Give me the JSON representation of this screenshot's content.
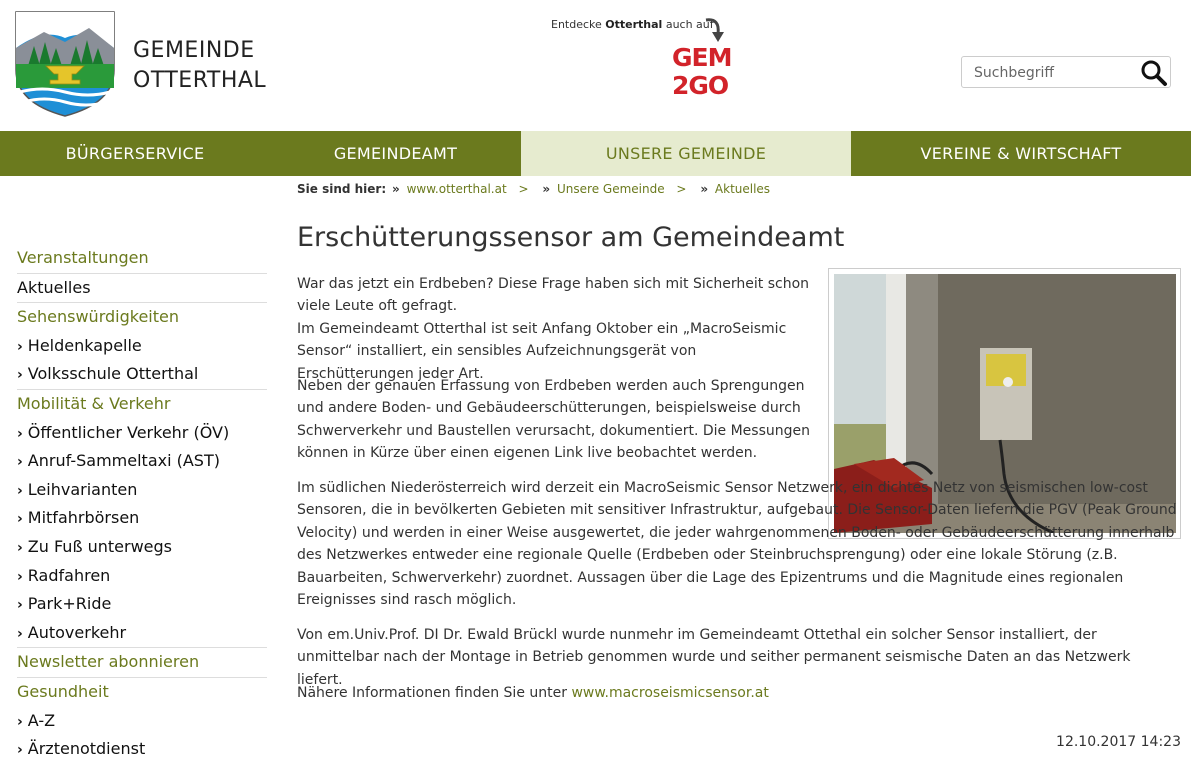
{
  "header": {
    "brand_line1": "GEMEINDE",
    "brand_line2": "OTTERTHAL",
    "g2g_prefix": "Entdecke",
    "g2g_name": "Otterthal",
    "g2g_suffix": "auch auf",
    "g2g_logo_line1": "GEM",
    "g2g_logo_line2": "2GO",
    "search_placeholder": "Suchbegriff"
  },
  "nav": {
    "items": [
      {
        "label": "BÜRGERSERVICE"
      },
      {
        "label": "GEMEINDEAMT"
      },
      {
        "label": "UNSERE GEMEINDE",
        "active": true
      },
      {
        "label": "VEREINE & WIRTSCHAFT"
      }
    ]
  },
  "breadcrumb": {
    "label": "Sie sind hier:",
    "items": [
      "www.otterthal.at",
      "Unsere Gemeinde",
      "Aktuelles"
    ]
  },
  "sidebar": {
    "items": [
      {
        "label": "Veranstaltungen",
        "type": "head"
      },
      {
        "label": "Aktuelles",
        "type": "plain"
      },
      {
        "label": "Sehenswürdigkeiten",
        "type": "head"
      },
      {
        "label": "Heldenkapelle",
        "type": "sub"
      },
      {
        "label": "Volksschule Otterthal",
        "type": "sub"
      },
      {
        "label": "Mobilität & Verkehr",
        "type": "head"
      },
      {
        "label": "Öffentlicher Verkehr (ÖV)",
        "type": "sub"
      },
      {
        "label": "Anruf-Sammeltaxi (AST)",
        "type": "sub"
      },
      {
        "label": "Leihvarianten",
        "type": "sub"
      },
      {
        "label": "Mitfahrbörsen",
        "type": "sub"
      },
      {
        "label": "Zu Fuß unterwegs",
        "type": "sub"
      },
      {
        "label": "Radfahren",
        "type": "sub"
      },
      {
        "label": "Park+Ride",
        "type": "sub"
      },
      {
        "label": "Autoverkehr",
        "type": "sub"
      },
      {
        "label": "Newsletter abonnieren",
        "type": "head"
      },
      {
        "label": "Gesundheit",
        "type": "head"
      },
      {
        "label": "A-Z",
        "type": "sub"
      },
      {
        "label": "Ärztenotdienst",
        "type": "sub"
      }
    ]
  },
  "article": {
    "title": "Erschütterungssensor am Gemeindeamt",
    "p1a": "War das jetzt ein Erdbeben? Diese Frage haben sich mit Sicherheit schon viele Leute oft gefragt.",
    "p1b": "Im Gemeindeamt Otterthal ist seit Anfang Oktober ein „MacroSeismic Sensor“ installiert, ein sensibles Aufzeichnungsgerät von Erschütterungen jeder Art.",
    "p2": "Neben der genauen Erfassung von Erdbeben werden auch Sprengungen und andere Boden- und Gebäudeerschütterungen, beispielsweise durch Schwerverkehr und Baustellen verursacht, dokumentiert. Die Messungen können in Kürze über einen eigenen Link live beobachtet werden.",
    "p3": "Im südlichen Niederösterreich wird derzeit ein MacroSeismic Sensor Netzwerk, ein dichtes Netz von seismischen low-cost Sensoren, die in bevölkerten Gebieten mit sensitiver Infrastruktur, aufgebaut. Die Sensor-Daten liefern die PGV (Peak Ground Velocity) und werden in einer Weise ausgewertet, die jeder wahrgenommenen Boden- oder Gebäudeerschütterung innerhalb des Netzwerkes entweder eine regionale Quelle (Erdbeben oder Steinbruchsprengung) oder eine lokale Störung (z.B. Bauarbeiten, Schwerverkehr) zuordnet. Aussagen über die Lage des Epizentrums und die Magnitude eines regionalen Ereignisses sind rasch möglich.",
    "p4": "Von em.Univ.Prof. DI Dr. Ewald Brückl wurde nunmehr im Gemeindeamt Ottethal ein solcher Sensor installiert, der unmittelbar nach der Montage in Betrieb genommen wurde und seither permanent seismische Daten an das Netzwerk liefert.",
    "p5_text": "Nähere Informationen finden Sie unter",
    "p5_link": "www.macroseismicsensor.at",
    "date": "12.10.2017 14:23"
  },
  "colors": {
    "nav_bg": "#6b7a1e",
    "nav_active_bg": "#e6ebcf",
    "accent_green": "#6b7a1e",
    "gem2go_red": "#d2232a"
  }
}
